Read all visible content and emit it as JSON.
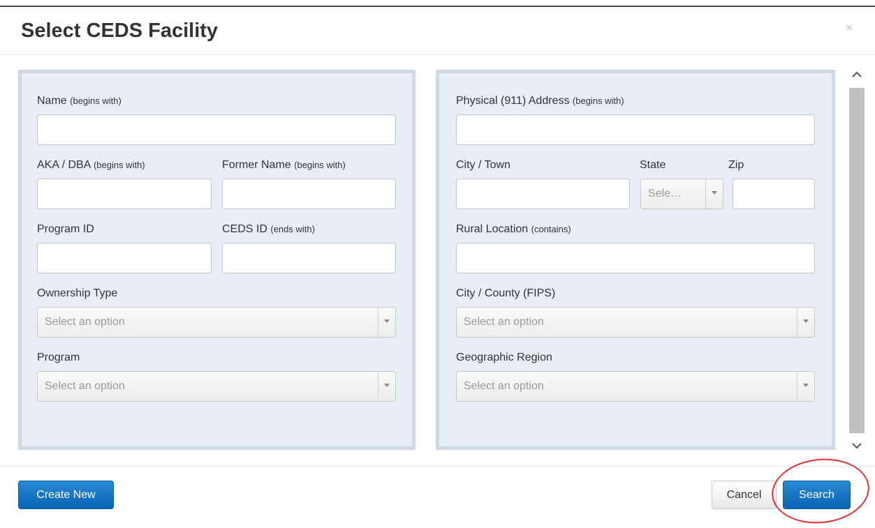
{
  "dialog": {
    "title": "Select CEDS Facility",
    "close_glyph": "×"
  },
  "left_panel": {
    "name_label": "Name",
    "name_hint": "(begins with)",
    "name_value": "",
    "aka_label": "AKA / DBA",
    "aka_hint": "(begins with)",
    "aka_value": "",
    "former_label": "Former Name",
    "former_hint": "(begins with)",
    "former_value": "",
    "program_id_label": "Program ID",
    "program_id_value": "",
    "ceds_label": "CEDS ID",
    "ceds_hint": "(ends with)",
    "ceds_value": "",
    "ownership_label": "Ownership Type",
    "ownership_placeholder": "Select an option",
    "program_label": "Program",
    "program_placeholder": "Select an option"
  },
  "right_panel": {
    "address_label": "Physical (911) Address",
    "address_hint": "(begins with)",
    "address_value": "",
    "city_label": "City / Town",
    "city_value": "",
    "state_label": "State",
    "state_placeholder": "Sele…",
    "zip_label": "Zip",
    "zip_value": "",
    "rural_label": "Rural Location",
    "rural_hint": "(contains)",
    "rural_value": "",
    "fips_label": "City / County (FIPS)",
    "fips_placeholder": "Select an option",
    "region_label": "Geographic Region",
    "region_placeholder": "Select an option"
  },
  "footer": {
    "create_label": "Create New",
    "cancel_label": "Cancel",
    "search_label": "Search"
  },
  "colors": {
    "primary": "#0b6ec4",
    "panel_bg": "#e9edf5",
    "panel_border": "#cfd8e5",
    "annotation": "#e43232"
  }
}
